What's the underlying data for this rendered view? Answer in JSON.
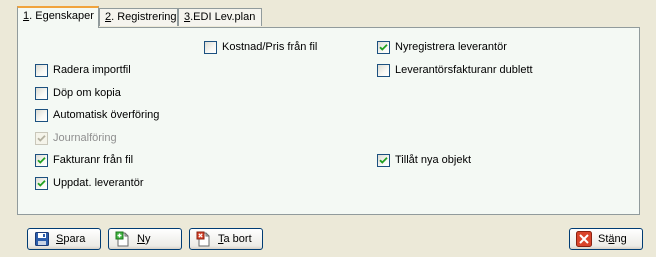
{
  "tabs": [
    {
      "mnemonic": "1",
      "rest": ". Egenskaper",
      "active": true
    },
    {
      "mnemonic": "2",
      "rest": ". Registrering",
      "active": false
    },
    {
      "mnemonic": "3",
      "rest": ".EDI Lev.plan",
      "active": false
    }
  ],
  "checkboxes": {
    "kostnad": {
      "label": "Kostnad/Pris från fil",
      "checked": false
    },
    "nyregistrera": {
      "label": "Nyregistrera leverantör",
      "checked": true
    },
    "radera": {
      "label": "Radera importfil",
      "checked": false
    },
    "dublett": {
      "label": "Leverantörsfakturanr dublett",
      "checked": false
    },
    "dop": {
      "label": "Döp om kopia",
      "checked": false
    },
    "auto": {
      "label": "Automatisk överföring",
      "checked": false
    },
    "journal": {
      "label": "Journalföring",
      "checked": true,
      "disabled": true
    },
    "fakturanr": {
      "label": "Fakturanr från fil",
      "checked": true
    },
    "tillat": {
      "label": "Tillåt nya objekt",
      "checked": true
    },
    "uppdat": {
      "label": "Uppdat. leverantör",
      "checked": true
    }
  },
  "buttons": {
    "spara": {
      "mnemonic": "S",
      "rest": "para",
      "icon": "floppy-disk-icon"
    },
    "ny": {
      "mnemonic": "N",
      "rest": "y",
      "icon": "new-document-icon"
    },
    "tabort": {
      "mnemonic": "T",
      "rest": "a bort",
      "icon": "delete-document-icon"
    },
    "stang": {
      "pre": "St",
      "mnemonic": "ä",
      "rest": "ng",
      "icon": "close-x-icon"
    }
  },
  "colors": {
    "accent_tab": "#f1a33c",
    "check": "#21a121",
    "close_red": "#d9442b"
  }
}
